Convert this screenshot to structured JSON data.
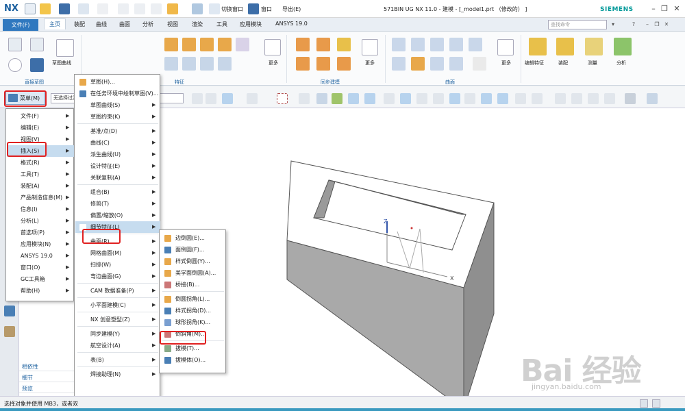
{
  "app": {
    "logo": "NX",
    "title": "571BIN UG NX 11.0 - 建模 - [_model1.prt  （修改的） ]",
    "brand": "SIEMENS",
    "quick_access": {
      "switch_window": "切换窗口",
      "window": "窗口",
      "import": "导出(E)"
    }
  },
  "ribbon": {
    "file_tab": "文件(F)",
    "tabs": [
      "主页",
      "装配",
      "曲线",
      "曲面",
      "分析",
      "视图",
      "渲染",
      "工具",
      "应用模块",
      "ANSYS 19.0"
    ],
    "active_tab": "主页",
    "command_search_placeholder": "查找命令",
    "labels": {
      "sketch_curve": "草图曲线",
      "direct_sketch": "直接草图",
      "feature": "特征",
      "sync_modeling": "同步建模",
      "surface": "曲面",
      "more": "更多",
      "edit_feature": "编辑特征",
      "assembly": "装配",
      "measure": "测量",
      "analysis": "分析"
    }
  },
  "toolbar": {
    "menu_button": "菜单(M)",
    "filter_label": "无选择过滤器"
  },
  "main_menu": {
    "items": [
      {
        "label": "文件(F)",
        "sub": true
      },
      {
        "label": "编辑(E)",
        "sub": true
      },
      {
        "label": "视图(V)",
        "sub": true
      },
      {
        "label": "插入(S)",
        "sub": true,
        "highlight": true
      },
      {
        "label": "格式(R)",
        "sub": true
      },
      {
        "label": "工具(T)",
        "sub": true
      },
      {
        "label": "装配(A)",
        "sub": true
      },
      {
        "label": "产品制造信息(M)",
        "sub": true
      },
      {
        "label": "信息(I)",
        "sub": true
      },
      {
        "label": "分析(L)",
        "sub": true
      },
      {
        "label": "首选项(P)",
        "sub": true
      },
      {
        "label": "应用模块(N)",
        "sub": true
      },
      {
        "label": "ANSYS 19.0",
        "sub": true
      },
      {
        "label": "窗口(O)",
        "sub": true
      },
      {
        "label": "GC工具箱",
        "sub": true
      },
      {
        "label": "帮助(H)",
        "sub": true
      }
    ]
  },
  "insert_menu": {
    "items": [
      {
        "label": "草图(H)...",
        "sub": false
      },
      {
        "label": "在任务环境中绘制草图(V)...",
        "sub": false
      },
      {
        "label": "草图曲线(S)",
        "sub": true
      },
      {
        "label": "草图约束(K)",
        "sub": true
      },
      {
        "label": "基准/点(D)",
        "sub": true
      },
      {
        "label": "曲线(C)",
        "sub": true
      },
      {
        "label": "派生曲线(U)",
        "sub": true
      },
      {
        "label": "设计特征(E)",
        "sub": true
      },
      {
        "label": "关联复制(A)",
        "sub": true
      },
      {
        "label": "组合(B)",
        "sub": true
      },
      {
        "label": "修剪(T)",
        "sub": true
      },
      {
        "label": "偏置/缩放(O)",
        "sub": true
      },
      {
        "label": "细节特征(L)",
        "sub": true,
        "highlight": true
      },
      {
        "label": "曲面(R)",
        "sub": true
      },
      {
        "label": "网格曲面(M)",
        "sub": true
      },
      {
        "label": "扫掠(W)",
        "sub": true
      },
      {
        "label": "弯边曲面(G)",
        "sub": true
      },
      {
        "label": "CAM 数据准备(P)",
        "sub": true
      },
      {
        "label": "小平面建模(C)",
        "sub": true
      },
      {
        "label": "NX 创意塑型(Z)",
        "sub": true
      },
      {
        "label": "同步建模(Y)",
        "sub": true
      },
      {
        "label": "航空设计(A)",
        "sub": true
      },
      {
        "label": "表(B)",
        "sub": true
      },
      {
        "label": "焊接助理(N)",
        "sub": true
      }
    ]
  },
  "detail_menu": {
    "items": [
      {
        "label": "边倒圆(E)..."
      },
      {
        "label": "面倒圆(F)..."
      },
      {
        "label": "样式倒圆(Y)..."
      },
      {
        "label": "美学面倒圆(A)..."
      },
      {
        "label": "桥接(B)..."
      },
      {
        "label": "倒圆拐角(L)..."
      },
      {
        "label": "样式拐角(D)..."
      },
      {
        "label": "球形拐角(K)..."
      },
      {
        "label": "倒斜角(M)...",
        "boxed": true
      },
      {
        "label": "拔模(T)..."
      },
      {
        "label": "拔模体(O)..."
      }
    ]
  },
  "navigator": {
    "rows": [
      "相依性",
      "细节",
      "预览"
    ]
  },
  "viewport": {
    "axis_x": "X",
    "axis_z": "Z"
  },
  "status": {
    "text": "选择对象并使用 MB3，或者双"
  },
  "watermark": {
    "main": "Bai 经验",
    "url": "jingyan.baidu.com"
  },
  "colors": {
    "accent": "#2f78bf",
    "highlight": "#c6dcef",
    "callout": "#e02020",
    "solid_side": "#9a9a9a",
    "solid_top": "#ffffff"
  }
}
